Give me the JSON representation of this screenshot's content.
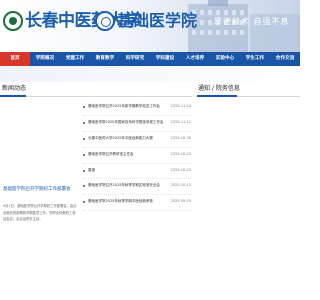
{
  "header": {
    "university_name": "长春中医药大学",
    "college_name": "基础医学院",
    "motto": "厚德精术  自强不息"
  },
  "nav": {
    "items": [
      {
        "label": "首页",
        "active": true
      },
      {
        "label": "学院概况",
        "active": false
      },
      {
        "label": "党建工作",
        "active": false
      },
      {
        "label": "教育教学",
        "active": false
      },
      {
        "label": "科学研究",
        "active": false
      },
      {
        "label": "学科建设",
        "active": false
      },
      {
        "label": "人才培养",
        "active": false
      },
      {
        "label": "实验中心",
        "active": false
      },
      {
        "label": "学生工作",
        "active": false
      },
      {
        "label": "合作交流",
        "active": false
      }
    ]
  },
  "news": {
    "section_title": "新闻动态",
    "featured": {
      "title": "基础医学院召开学期初工作部署会",
      "summary": "9月1日，基础医学院召开学期初工作部署会，会议全面安排部署新学期各项工作。学院全体教职工参加会议，会议由院长主持。"
    },
    "items": [
      {
        "title": "基础医学院召开2025年新学期教学检查工作会",
        "date": "2025-11-14"
      },
      {
        "title": "基础医学院2025年国家自然科学基金申报工作会",
        "date": "2025-11-11"
      },
      {
        "title": "长春中医药大学2025年中医经典能力大赛",
        "date": "2025-10-30"
      },
      {
        "title": "基础医学院召开教研室主任会",
        "date": "2025-10-23"
      },
      {
        "title": "喜报",
        "date": "2025-10-23"
      },
      {
        "title": "基础医学院召开2025年秋季学期实验室安全会",
        "date": "2025-10-12"
      },
      {
        "title": "基础医学院2025年秋季学期中医经典考核",
        "date": "2025-09-03"
      }
    ]
  },
  "notice": {
    "section_title": "通知 / 院务信息"
  },
  "colors": {
    "nav_blue": "#1a56a8",
    "nav_active_red": "#d8382a",
    "title_blue": "#1d5fad"
  }
}
